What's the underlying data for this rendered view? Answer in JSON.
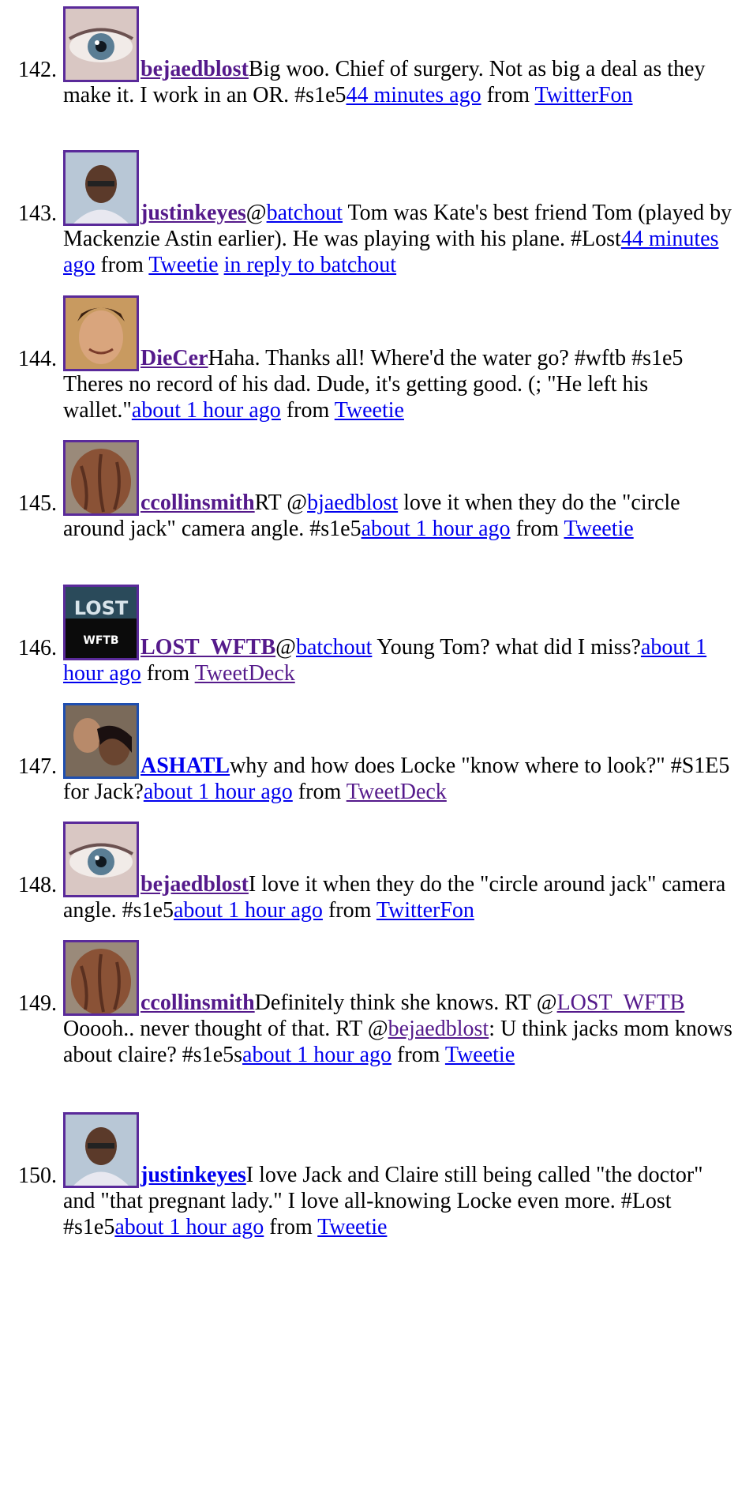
{
  "entries": [
    {
      "number": "142.",
      "avatar": "eye-avatar",
      "user": "bejaedblost",
      "text_before": "Big woo. Chief of surgery. Not as big a deal as they make it. I work in an OR. #s1e5",
      "time": "44 minutes ago",
      "from": " from ",
      "source": "TwitterFon",
      "reply": ""
    },
    {
      "number": "143.",
      "avatar": "man-avatar",
      "user": "justinkeyes",
      "pre": "@",
      "mention": "batchout",
      "text_before": " Tom was Kate's best friend Tom (played by Mackenzie Astin earlier). He was playing with his plane. #Lost",
      "time": "44 minutes ago",
      "from": " from ",
      "source": "Tweetie",
      "reply": "in reply to batchout"
    },
    {
      "number": "144.",
      "avatar": "smiling-avatar",
      "user": "DieCer",
      "text_before": "Haha. Thanks all! Where'd the water go? #wftb #s1e5 Theres no record of his dad. Dude, it's getting good. (; \"He left his wallet.\"",
      "time": "about 1 hour ago",
      "from": " from ",
      "source": "Tweetie",
      "reply": ""
    },
    {
      "number": "145.",
      "avatar": "hair-avatar",
      "user": "ccollinsmith",
      "pre": "RT @",
      "mention": "bjaedblost",
      "text_before": " love it when they do the \"circle around jack\" camera angle. #s1e5",
      "time": "about 1 hour ago",
      "from": " from ",
      "source": "Tweetie",
      "reply": ""
    },
    {
      "number": "146.",
      "avatar": "lost-logo-avatar",
      "avatar_text": "WFTB",
      "user": "LOST_WFTB",
      "pre": "@",
      "mention": "batchout",
      "text_before": " Young Tom? what did I miss?",
      "time": "about 1 hour ago",
      "from": " from ",
      "source": "TweetDeck",
      "reply": ""
    },
    {
      "number": "147.",
      "avatar": "couple-avatar",
      "user": "ASHATL",
      "text_before": "why and how does Locke \"know where to look?\" #S1E5 for Jack?",
      "time": "about 1 hour ago",
      "from": " from ",
      "source": "TweetDeck",
      "reply": ""
    },
    {
      "number": "148.",
      "avatar": "eye-avatar",
      "user": "bejaedblost",
      "text_before": "I love it when they do the \"circle around jack\" camera angle. #s1e5",
      "time": "about 1 hour ago",
      "from": " from ",
      "source": "TwitterFon",
      "reply": ""
    },
    {
      "number": "149.",
      "avatar": "hair-avatar",
      "user": "ccollinsmith",
      "text_before": "Definitely think she knows. RT @",
      "mention": "LOST_WFTB",
      "mid": " Ooooh.. never thought of that. RT @",
      "mention2": "bejaedblost",
      "text_after": ": U think jacks mom knows about claire? #s1e5s",
      "time": "about 1 hour ago",
      "from": " from ",
      "source": "Tweetie",
      "reply": ""
    },
    {
      "number": "150.",
      "avatar": "man-avatar",
      "user": "justinkeyes",
      "text_before": "I love Jack and Claire still being called \"the doctor\" and \"that pregnant lady.\" I love all-knowing Locke even more. #Lost #s1e5",
      "time": "about 1 hour ago",
      "from": " from ",
      "source": "Tweetie",
      "reply": ""
    }
  ],
  "spacer_link": "_",
  "colors": {
    "link": "#0000ee",
    "visited": "#551a8b",
    "avatar_border": "#5a2a9a"
  }
}
